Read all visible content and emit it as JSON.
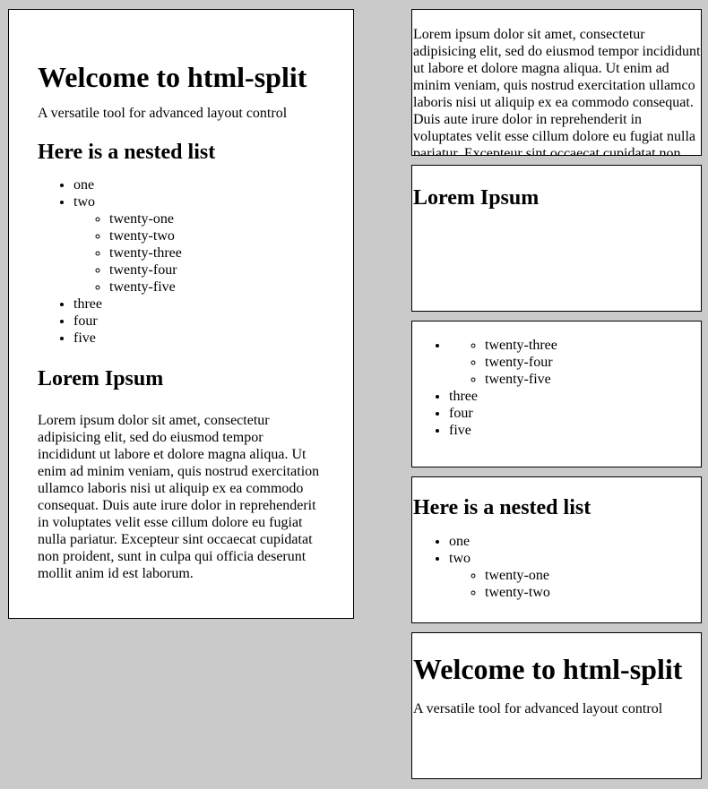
{
  "document": {
    "title": "Welcome to html-split",
    "tagline": "A versatile tool for advanced layout control",
    "list_heading": "Here is a nested list",
    "list": {
      "one": "one",
      "two": "two",
      "nested": [
        "twenty-one",
        "twenty-two",
        "twenty-three",
        "twenty-four",
        "twenty-five"
      ],
      "three": "three",
      "four": "four",
      "five": "five"
    },
    "lorem_heading": "Lorem Ipsum",
    "lorem_text": "Lorem ipsum dolor sit amet, consectetur adipisicing elit, sed do eiusmod tempor incididunt ut labore et dolore magna aliqua. Ut enim ad minim veniam, quis nostrud exercitation ullamco laboris nisi ut aliquip ex ea commodo consequat. Duis aute irure dolor in reprehenderit in voluptates velit esse cillum dolore eu fugiat nulla pariatur. Excepteur sint occaecat cupidatat non proident, sunt in culpa qui officia deserunt mollit anim id est laborum."
  }
}
